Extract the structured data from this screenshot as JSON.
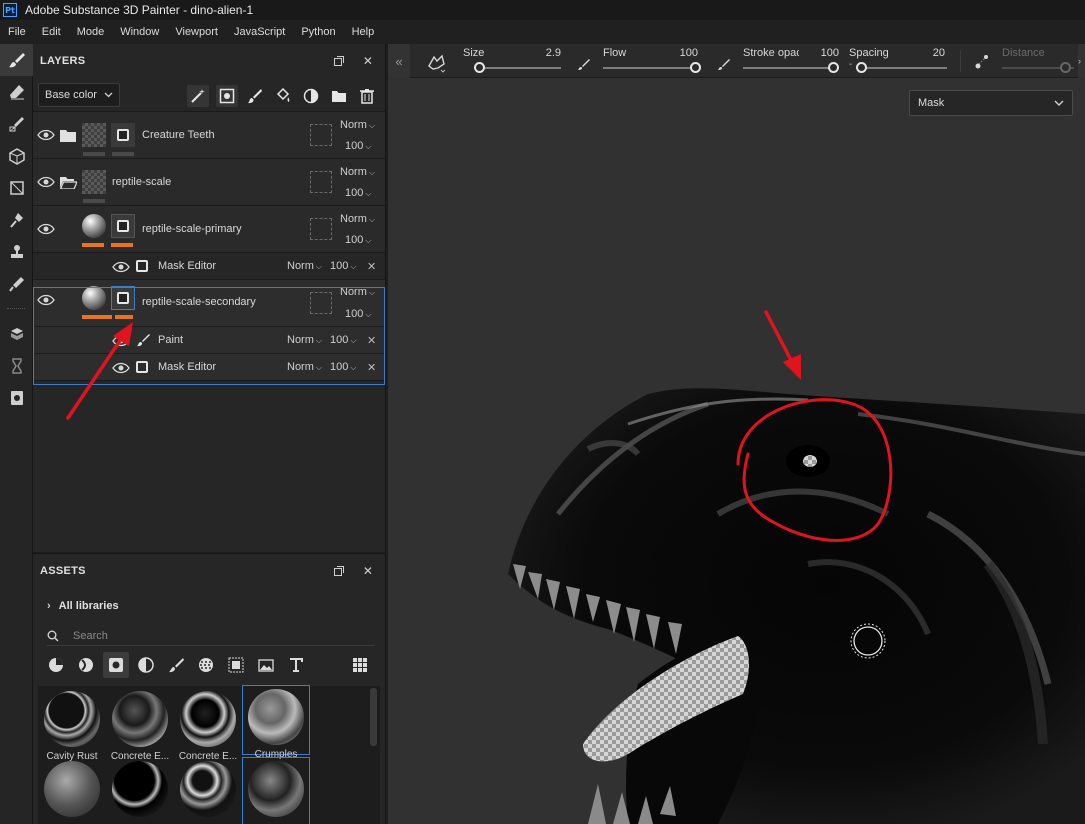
{
  "window": {
    "app_badge": "Pt",
    "title": "Adobe Substance 3D Painter - dino-alien-1"
  },
  "menu": [
    "File",
    "Edit",
    "Mode",
    "Window",
    "Viewport",
    "JavaScript",
    "Python",
    "Help"
  ],
  "toolbar_icons": [
    "paint-brush-icon",
    "eraser-icon",
    "projection-icon",
    "geometry-fill-icon",
    "polygon-fill-icon",
    "smudge-icon",
    "clone-stamp-icon",
    "color-picker-icon",
    "bake-icon",
    "history-icon",
    "export-icon"
  ],
  "layers_panel": {
    "title": "LAYERS",
    "channel": "Base color",
    "layers": [
      {
        "name": "Creature Teeth",
        "type": "folder",
        "blend": "Norm",
        "opacity": "100",
        "has_mask": true
      },
      {
        "name": "reptile-scale",
        "type": "folder-open",
        "blend": "Norm",
        "opacity": "100",
        "has_mask": false
      },
      {
        "name": "reptile-scale-primary",
        "type": "fill",
        "blend": "Norm",
        "opacity": "100",
        "has_mask": true,
        "effects": [
          {
            "name": "Mask Editor",
            "blend": "Norm",
            "opacity": "100"
          }
        ]
      },
      {
        "name": "reptile-scale-secondary",
        "type": "fill",
        "blend": "Norm",
        "opacity": "100",
        "has_mask": true,
        "selected": true,
        "effects": [
          {
            "name": "Paint",
            "blend": "Norm",
            "opacity": "100"
          },
          {
            "name": "Mask Editor",
            "blend": "Norm",
            "opacity": "100"
          }
        ]
      }
    ]
  },
  "assets_panel": {
    "title": "ASSETS",
    "libraries_label": "All libraries",
    "search_placeholder": "Search",
    "items": [
      {
        "label": "Cavity Rust"
      },
      {
        "label": "Concrete E..."
      },
      {
        "label": "Concrete E..."
      },
      {
        "label": "Crumples",
        "selected": true
      },
      {
        "label": ""
      },
      {
        "label": ""
      },
      {
        "label": ""
      },
      {
        "label": ""
      }
    ]
  },
  "brush_params": {
    "size": {
      "label": "Size",
      "value": "2.9",
      "fraction": 0.02
    },
    "flow": {
      "label": "Flow",
      "value": "100",
      "fraction": 1.0
    },
    "stroke_opacity": {
      "label": "Stroke opac",
      "value": "100",
      "fraction": 1.0
    },
    "spacing": {
      "label": "Spacing",
      "value": "20",
      "fraction": 0.0
    },
    "distance": {
      "label": "Distance",
      "value": "",
      "fraction": 0.88,
      "disabled": true
    }
  },
  "viewport": {
    "channel_view": "Mask"
  },
  "colors": {
    "accent_blue": "#3d7ecb",
    "layer_orange": "#e8741e",
    "annotation_red": "#e0141e"
  }
}
